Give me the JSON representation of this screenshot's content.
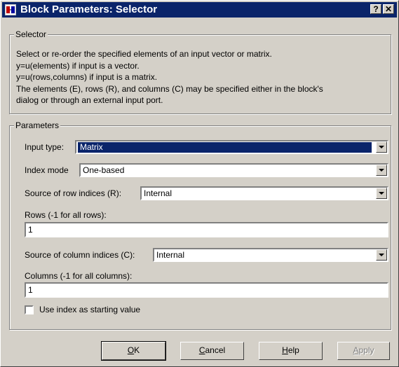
{
  "window": {
    "title": "Block Parameters: Selector",
    "help_button": "?",
    "close_button": "✕"
  },
  "selector_group": {
    "label": "Selector",
    "description": [
      "Select or re-order the specified elements of an input vector or matrix.",
      "y=u(elements) if input is a vector.",
      "y=u(rows,columns) if input is a matrix.",
      "The elements (E), rows (R), and columns (C) may be specified either in the block's",
      "dialog or through an external input port."
    ]
  },
  "parameters_group": {
    "label": "Parameters",
    "input_type": {
      "label": "Input type:",
      "value": "Matrix"
    },
    "index_mode": {
      "label": "Index mode",
      "value": "One-based"
    },
    "row_source": {
      "label": "Source of row indices (R):",
      "value": "Internal"
    },
    "rows": {
      "label": "Rows (-1 for all rows):",
      "value": "1"
    },
    "col_source": {
      "label": "Source of column indices (C):",
      "value": "Internal"
    },
    "columns": {
      "label": "Columns (-1 for all columns):",
      "value": "1"
    },
    "use_index_start": {
      "label": "Use index as starting value",
      "checked": false
    }
  },
  "buttons": {
    "ok": {
      "mnemonic": "O",
      "rest": "K"
    },
    "cancel": {
      "mnemonic": "C",
      "rest": "ancel"
    },
    "help": {
      "mnemonic": "H",
      "rest": "elp"
    },
    "apply": {
      "mnemonic": "A",
      "rest": "pply"
    }
  },
  "colors": {
    "titlebar": "#0a246a",
    "face": "#d4d0c8",
    "selection": "#0a246a"
  }
}
